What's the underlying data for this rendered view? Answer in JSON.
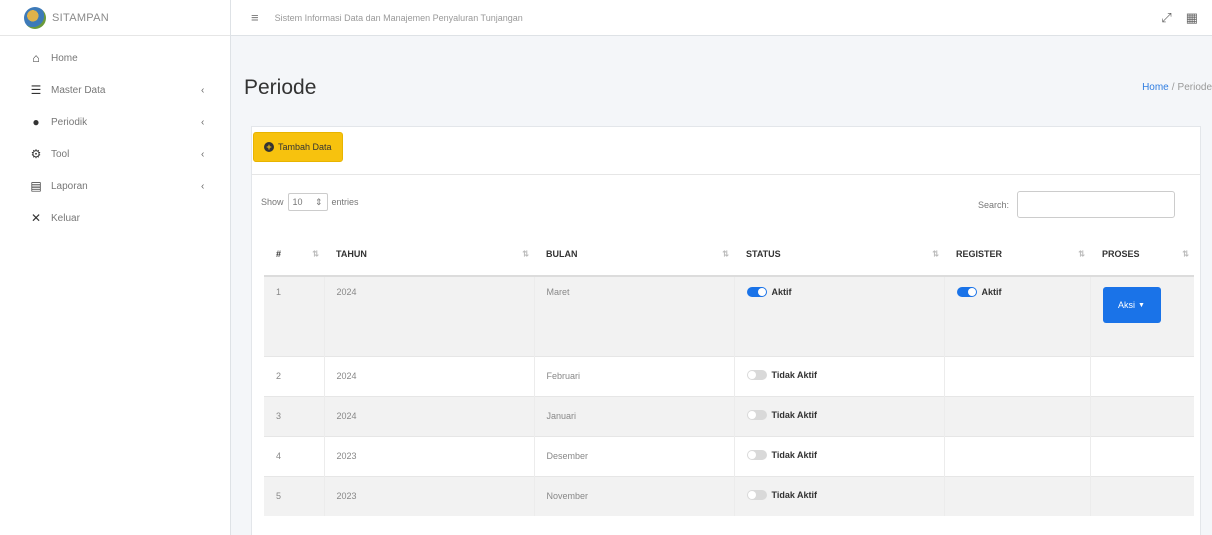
{
  "brand": {
    "name": "SITAMPAN"
  },
  "sidebar": {
    "items": [
      {
        "label": "Home",
        "icon": "home-icon",
        "glyph": "⌂",
        "chevron": ""
      },
      {
        "label": "Master Data",
        "icon": "database-icon",
        "glyph": "☰",
        "chevron": "‹"
      },
      {
        "label": "Periodik",
        "icon": "circle-icon",
        "glyph": "●",
        "chevron": "‹"
      },
      {
        "label": "Tool",
        "icon": "gear-icon",
        "glyph": "⚙",
        "chevron": "‹"
      },
      {
        "label": "Laporan",
        "icon": "book-icon",
        "glyph": "▤",
        "chevron": "‹"
      },
      {
        "label": "Keluar",
        "icon": "close-icon",
        "glyph": "✕",
        "chevron": ""
      }
    ]
  },
  "topbar": {
    "title": "Sistem Informasi Data dan Manajemen Penyaluran Tunjangan",
    "hamburger_glyph": "≡",
    "expand_glyph": "⤢",
    "grid_glyph": "▦"
  },
  "page": {
    "title": "Periode",
    "breadcrumb": {
      "home": "Home",
      "separator": "/",
      "current": "Periode"
    }
  },
  "actions": {
    "add_label": "Tambah Data",
    "add_glyph": "+"
  },
  "table_controls": {
    "show_label": "Show",
    "entries_value": "10",
    "entries_label": "entries",
    "search_label": "Search:",
    "search_value": ""
  },
  "table": {
    "columns": [
      "#",
      "TAHUN",
      "BULAN",
      "STATUS",
      "REGISTER",
      "PROSES"
    ],
    "sort_glyph": "⇅",
    "rows": [
      {
        "no": "1",
        "tahun": "2024",
        "bulan": "Maret",
        "status": "Aktif",
        "status_on": true,
        "register": "Aktif",
        "register_on": true,
        "proses": "Aksi"
      },
      {
        "no": "2",
        "tahun": "2024",
        "bulan": "Februari",
        "status": "Tidak Aktif",
        "status_on": false,
        "register": "",
        "register_on": null,
        "proses": ""
      },
      {
        "no": "3",
        "tahun": "2024",
        "bulan": "Januari",
        "status": "Tidak Aktif",
        "status_on": false,
        "register": "",
        "register_on": null,
        "proses": ""
      },
      {
        "no": "4",
        "tahun": "2023",
        "bulan": "Desember",
        "status": "Tidak Aktif",
        "status_on": false,
        "register": "",
        "register_on": null,
        "proses": ""
      },
      {
        "no": "5",
        "tahun": "2023",
        "bulan": "November",
        "status": "Tidak Aktif",
        "status_on": false,
        "register": "",
        "register_on": null,
        "proses": ""
      }
    ]
  },
  "colors": {
    "accent": "#1a73e8",
    "warning": "#f7c20e",
    "switch_off": "#d9d9d9"
  }
}
